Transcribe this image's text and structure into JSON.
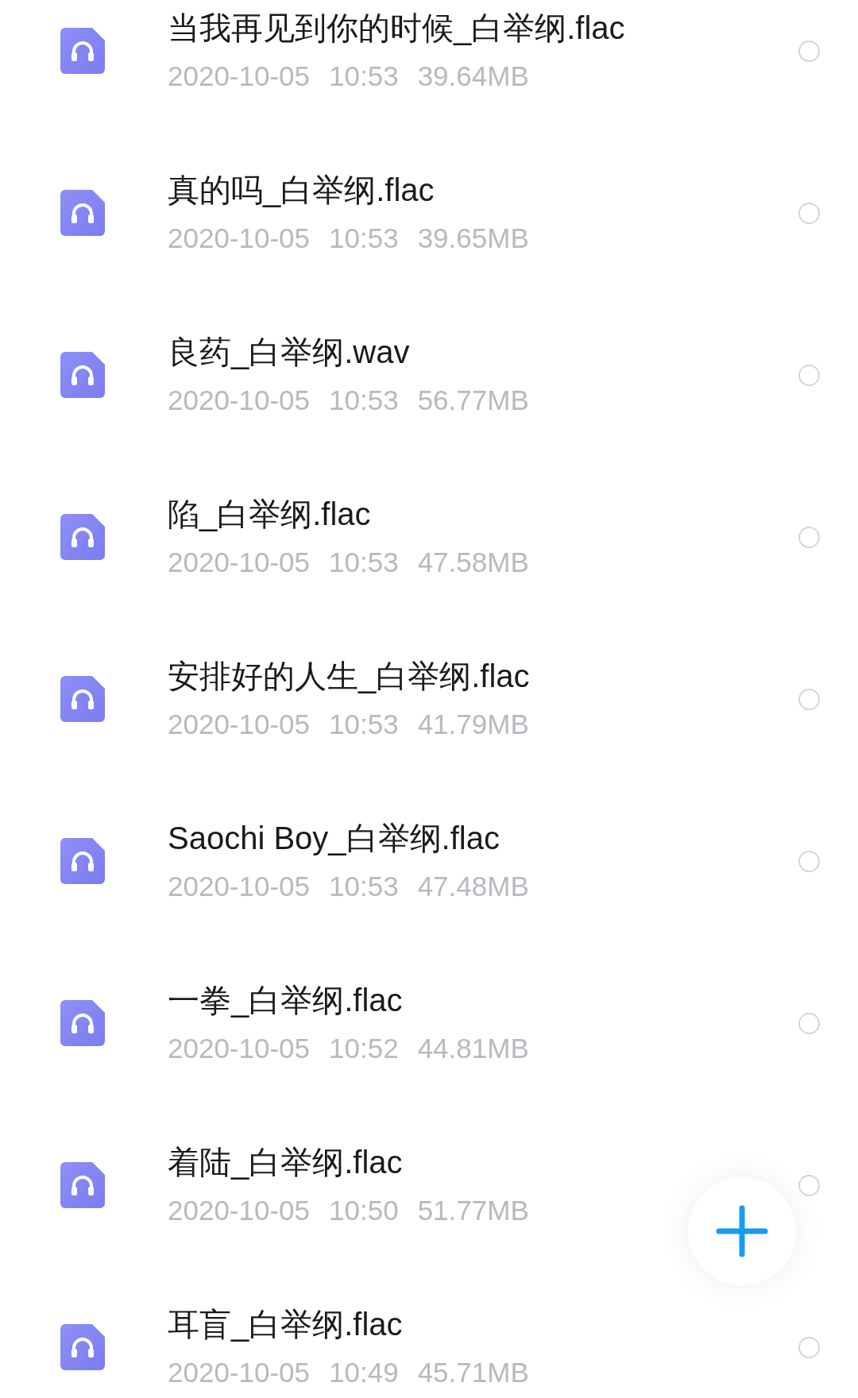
{
  "files": [
    {
      "name": "当我再见到你的时候_白举纲.flac",
      "date": "2020-10-05",
      "time": "10:53",
      "size": "39.64MB",
      "selected": false
    },
    {
      "name": "真的吗_白举纲.flac",
      "date": "2020-10-05",
      "time": "10:53",
      "size": "39.65MB",
      "selected": false
    },
    {
      "name": "良药_白举纲.wav",
      "date": "2020-10-05",
      "time": "10:53",
      "size": "56.77MB",
      "selected": false
    },
    {
      "name": "陷_白举纲.flac",
      "date": "2020-10-05",
      "time": "10:53",
      "size": "47.58MB",
      "selected": false
    },
    {
      "name": "安排好的人生_白举纲.flac",
      "date": "2020-10-05",
      "time": "10:53",
      "size": "41.79MB",
      "selected": false
    },
    {
      "name": "Saochi Boy_白举纲.flac",
      "date": "2020-10-05",
      "time": "10:53",
      "size": "47.48MB",
      "selected": false
    },
    {
      "name": "一拳_白举纲.flac",
      "date": "2020-10-05",
      "time": "10:52",
      "size": "44.81MB",
      "selected": false
    },
    {
      "name": "着陆_白举纲.flac",
      "date": "2020-10-05",
      "time": "10:50",
      "size": "51.77MB",
      "selected": false
    },
    {
      "name": "耳盲_白举纲.flac",
      "date": "2020-10-05",
      "time": "10:49",
      "size": "45.71MB",
      "selected": false
    }
  ]
}
